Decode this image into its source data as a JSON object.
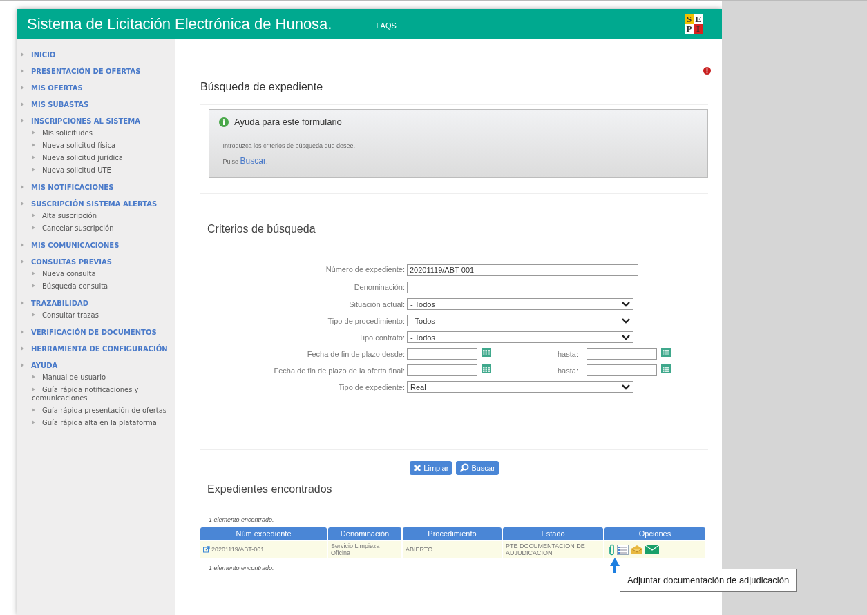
{
  "header": {
    "title": "Sistema de Licitación Electrónica de Hunosa.",
    "link": "FAQS",
    "logo": [
      "S",
      "E",
      "P",
      "I"
    ]
  },
  "sidebar": {
    "items": [
      {
        "label": "INICIO"
      },
      {
        "label": "PRESENTACIÓN DE OFERTAS"
      },
      {
        "label": "MIS OFERTAS"
      },
      {
        "label": "MIS SUBASTAS"
      },
      {
        "label": "INSCRIPCIONES AL SISTEMA",
        "children": [
          "Mis solicitudes",
          "Nueva solicitud física",
          "Nueva solicitud jurídica",
          "Nueva solicitud UTE"
        ]
      },
      {
        "label": "MIS NOTIFICACIONES"
      },
      {
        "label": "SUSCRIPCIÓN SISTEMA ALERTAS",
        "children": [
          "Alta suscripción",
          "Cancelar suscripción"
        ]
      },
      {
        "label": "MIS COMUNICACIONES"
      },
      {
        "label": "CONSULTAS PREVIAS",
        "children": [
          "Nueva consulta",
          "Búsqueda consulta"
        ]
      },
      {
        "label": "TRAZABILIDAD",
        "children": [
          "Consultar trazas"
        ]
      },
      {
        "label": "VERIFICACIÓN DE DOCUMENTOS"
      },
      {
        "label": "HERRAMIENTA DE CONFIGURACIÓN"
      },
      {
        "label": "AYUDA",
        "children": [
          "Manual de usuario",
          "Guía rápida notificaciones y comunicaciones",
          "Guía rápida presentación de ofertas",
          "Guía rápida alta en la plataforma"
        ]
      }
    ]
  },
  "page": {
    "title": "Búsqueda de expediente"
  },
  "help": {
    "title": "Ayuda para este formulario",
    "line1": "- Introduzca los criterios de búsqueda que desee.",
    "line2_prefix": "- Pulse",
    "line2_link": "Buscar",
    "line2_suffix": "."
  },
  "criteria": {
    "title": "Criterios de búsqueda",
    "fields": [
      {
        "kind": "text",
        "label": "Número de expediente:",
        "value": "20201119/ABT-001"
      },
      {
        "kind": "text",
        "label": "Denominación:"
      },
      {
        "kind": "select",
        "label": "Situación actual:",
        "value": "- Todos"
      },
      {
        "kind": "select",
        "label": "Tipo de procedimiento:",
        "value": "- Todos"
      },
      {
        "kind": "select",
        "label": "Tipo contrato:",
        "value": "- Todos"
      },
      {
        "kind": "daterange",
        "label": "Fecha de fin de plazo desde:",
        "to_label": "hasta:"
      },
      {
        "kind": "daterange",
        "label": "Fecha de fin de plazo de la oferta final:",
        "to_label": "hasta:"
      },
      {
        "kind": "select",
        "label": "Tipo de expediente:",
        "value": "Real"
      }
    ]
  },
  "buttons": [
    {
      "kind": "clear",
      "label": "Limpiar"
    },
    {
      "kind": "search",
      "label": "Buscar"
    }
  ],
  "results": {
    "title": "Expedientes encontrados",
    "count_top": "1 elemento encontrado.",
    "count_bottom": "1 elemento encontrado.",
    "columns": [
      "Núm expediente",
      "Denominación",
      "Procedimiento",
      "Estado",
      "Opciones"
    ],
    "rows": [
      {
        "number": "20201119/ABT-001",
        "name": "Servicio Limpieza Oficina",
        "procedure": "ABIERTO",
        "status": "PTE DOCUMENTACION DE ADJUDICACION"
      }
    ],
    "tooltip": "Adjuntar documentación de adjudicación"
  }
}
